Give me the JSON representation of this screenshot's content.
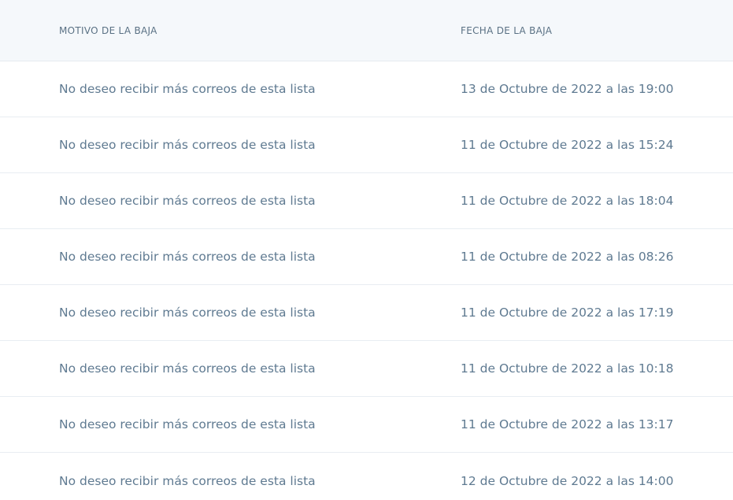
{
  "table": {
    "headers": {
      "reason": "MOTIVO DE LA BAJA",
      "date": "FECHA DE LA BAJA"
    },
    "rows": [
      {
        "reason": "No deseo recibir más correos de esta lista",
        "date": "13 de Octubre de 2022 a las 19:00"
      },
      {
        "reason": "No deseo recibir más correos de esta lista",
        "date": "11 de Octubre de 2022 a las 15:24"
      },
      {
        "reason": "No deseo recibir más correos de esta lista",
        "date": "11 de Octubre de 2022 a las 18:04"
      },
      {
        "reason": "No deseo recibir más correos de esta lista",
        "date": "11 de Octubre de 2022 a las 08:26"
      },
      {
        "reason": "No deseo recibir más correos de esta lista",
        "date": "11 de Octubre de 2022 a las 17:19"
      },
      {
        "reason": "No deseo recibir más correos de esta lista",
        "date": "11 de Octubre de 2022 a las 10:18"
      },
      {
        "reason": "No deseo recibir más correos de esta lista",
        "date": "11 de Octubre de 2022 a las 13:17"
      },
      {
        "reason": "No deseo recibir más correos de esta lista",
        "date": "12 de Octubre de 2022 a las 14:00"
      }
    ]
  }
}
